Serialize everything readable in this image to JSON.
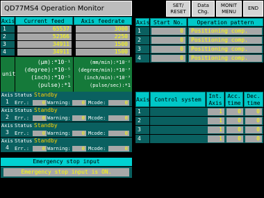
{
  "title": "QD77MS4 Operation Monitor",
  "toolbar": {
    "set_reset": "SET/\nRESET",
    "data_chg": "Data\nChg.",
    "monit_menu": "MONIT\nMENU",
    "end": "END"
  },
  "feed_table": {
    "headers": [
      "Axis",
      "Current feed val.",
      "Axis feedrate"
    ],
    "rows": [
      {
        "axis": "1",
        "current": "65537",
        "feedrate": "3000"
      },
      {
        "axis": "2",
        "current": "52366",
        "feedrate": "2250"
      },
      {
        "axis": "3",
        "current": "34911",
        "feedrate": "1500"
      },
      {
        "axis": "4",
        "current": "34911",
        "feedrate": "1500"
      }
    ],
    "unit_label": "unit",
    "units_left": [
      "(μm):*10⁻¹",
      "(degree):*10⁻⁵",
      "(inch):*10⁻⁵",
      "(pulse):*1"
    ],
    "units_right": [
      "(mm/min):*10⁻²",
      "(degree/min):*10⁻³",
      "(inch/min):*10⁻³",
      "(pulse/sec):*1"
    ]
  },
  "status_blocks": [
    {
      "axis": "1",
      "status_label": "Status",
      "status": "Standby",
      "err_label": "Err.:",
      "err": "0",
      "warn_label": "Warning:",
      "warn": "0",
      "mcode_label": "Mcode:",
      "mcode": "0"
    },
    {
      "axis": "2",
      "status_label": "Status",
      "status": "Standby",
      "err_label": "Err.:",
      "err": "0",
      "warn_label": "Warning:",
      "warn": "0",
      "mcode_label": "Mcode:",
      "mcode": "0"
    },
    {
      "axis": "3",
      "status_label": "Status",
      "status": "Standby",
      "err_label": "Err.:",
      "err": "0",
      "warn_label": "Warning:",
      "warn": "0",
      "mcode_label": "Mcode:",
      "mcode": "0"
    },
    {
      "axis": "4",
      "status_label": "Status",
      "status": "Standby",
      "err_label": "Err.:",
      "err": "0",
      "warn_label": "Warning:",
      "warn": "0",
      "mcode_label": "Mcode:",
      "mcode": "0"
    }
  ],
  "axis_label": "Axis",
  "emergency": {
    "header": "Emergency stop input",
    "message": "Emergency stop input is ON."
  },
  "pattern_table": {
    "headers": [
      "Axis",
      "Start No.",
      "Operation pattern"
    ],
    "rows": [
      {
        "axis": "1",
        "start": "0",
        "pattern": "Positioning comp."
      },
      {
        "axis": "2",
        "start": "0",
        "pattern": "Positioning comp."
      },
      {
        "axis": "3",
        "start": "0",
        "pattern": "Positioning comp."
      },
      {
        "axis": "4",
        "start": "0",
        "pattern": "Positioning comp."
      }
    ]
  },
  "control_table": {
    "headers": [
      "Axis",
      "Control system",
      "Int.\nAxis",
      "Acc.\ntime",
      "Dec.\ntime"
    ],
    "rows": [
      {
        "axis": "1",
        "control": "",
        "int": "1",
        "acc": "0",
        "dec": "0"
      },
      {
        "axis": "2",
        "control": "",
        "int": "1",
        "acc": "0",
        "dec": "0"
      },
      {
        "axis": "3",
        "control": "",
        "int": "1",
        "acc": "0",
        "dec": "0"
      },
      {
        "axis": "4",
        "control": "",
        "int": "1",
        "acc": "0",
        "dec": "0"
      }
    ]
  },
  "colors": {
    "background": "#000000",
    "header": "#00c8c8",
    "value_text": "#ffff00",
    "standby": "#ffd000"
  }
}
